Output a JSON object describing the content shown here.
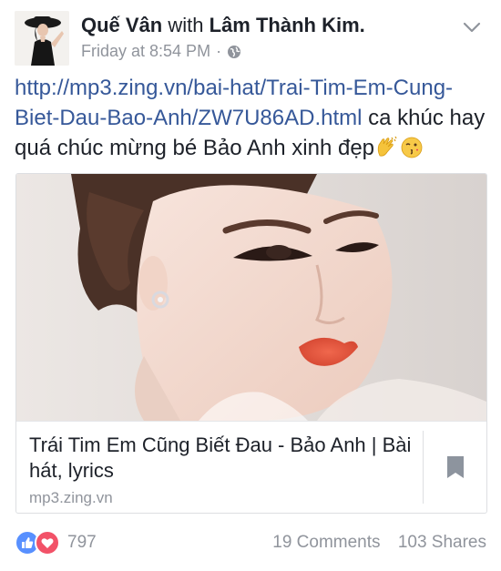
{
  "post": {
    "author_name": "Quế Vân",
    "with_word": "with",
    "tagged_name": "Lâm Thành Kim.",
    "timestamp": "Friday at 8:54 PM",
    "separator": "·",
    "privacy_icon": "globe-icon",
    "menu_icon": "chevron-down-icon",
    "link_url": "http://mp3.zing.vn/bai-hat/Trai-Tim-Em-Cung-Biet-Dau-Bao-Anh/ZW7U86AD.html",
    "message": " ca khúc hay quá chúc mừng bé Bảo Anh xinh đẹp",
    "emojis": [
      "clapping-hands-emoji",
      "face-blowing-kiss-emoji"
    ]
  },
  "link_card": {
    "title": "Trái Tim Em Cũng Biết Đau - Bảo Anh | Bài hát, lyrics",
    "domain": "mp3.zing.vn",
    "save_icon": "bookmark-icon"
  },
  "footer": {
    "reactions": [
      "like",
      "love"
    ],
    "reaction_count": "797",
    "comments": "19 Comments",
    "shares": "103 Shares"
  },
  "colors": {
    "link": "#365899",
    "secondary_text": "#90949c",
    "like": "#5890ff",
    "love": "#f25268"
  }
}
